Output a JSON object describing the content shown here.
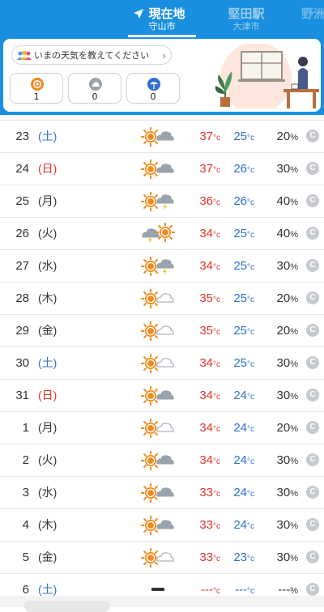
{
  "header": {
    "current": {
      "name": "現在地",
      "sub": "守山市"
    },
    "other": {
      "name": "堅田駅",
      "sub": "大津市"
    },
    "edge": {
      "name": "野洲"
    }
  },
  "report": {
    "prompt": "いまの天気を教えてください",
    "votes": [
      {
        "icon": "sun-icon",
        "count": "1"
      },
      {
        "icon": "cloud-icon",
        "count": "0"
      },
      {
        "icon": "umbrella-icon",
        "count": "0"
      }
    ]
  },
  "forecast": [
    {
      "day": "23",
      "weekday": "(土)",
      "type": "sat",
      "icon": "sun-cloud",
      "high": "37",
      "low": "25",
      "pop": "20"
    },
    {
      "day": "24",
      "weekday": "(日)",
      "type": "sun",
      "icon": "sun-cloud",
      "high": "37",
      "low": "26",
      "pop": "30"
    },
    {
      "day": "25",
      "weekday": "(月)",
      "type": "wk",
      "icon": "sun-thunder",
      "high": "36",
      "low": "26",
      "pop": "40"
    },
    {
      "day": "26",
      "weekday": "(火)",
      "type": "wk",
      "icon": "thunder-sun",
      "high": "34",
      "low": "25",
      "pop": "40"
    },
    {
      "day": "27",
      "weekday": "(水)",
      "type": "wk",
      "icon": "sun-thunder",
      "high": "34",
      "low": "25",
      "pop": "30"
    },
    {
      "day": "28",
      "weekday": "(木)",
      "type": "wk",
      "icon": "sun-white-cloud",
      "high": "35",
      "low": "25",
      "pop": "20"
    },
    {
      "day": "29",
      "weekday": "(金)",
      "type": "wk",
      "icon": "sun-white-cloud",
      "high": "35",
      "low": "25",
      "pop": "20"
    },
    {
      "day": "30",
      "weekday": "(土)",
      "type": "sat",
      "icon": "sun-white-cloud",
      "high": "34",
      "low": "25",
      "pop": "30"
    },
    {
      "day": "31",
      "weekday": "(日)",
      "type": "sun",
      "icon": "sun-cloud",
      "high": "34",
      "low": "24",
      "pop": "30"
    },
    {
      "day": "1",
      "weekday": "(月)",
      "type": "wk",
      "icon": "sun-white-cloud",
      "high": "34",
      "low": "24",
      "pop": "20"
    },
    {
      "day": "2",
      "weekday": "(火)",
      "type": "wk",
      "icon": "sun-cloud",
      "high": "34",
      "low": "24",
      "pop": "30"
    },
    {
      "day": "3",
      "weekday": "(水)",
      "type": "wk",
      "icon": "sun-cloud",
      "high": "33",
      "low": "24",
      "pop": "30"
    },
    {
      "day": "4",
      "weekday": "(木)",
      "type": "wk",
      "icon": "sun-cloud",
      "high": "33",
      "low": "24",
      "pop": "30"
    },
    {
      "day": "5",
      "weekday": "(金)",
      "type": "wk",
      "icon": "sun-white-cloud",
      "high": "33",
      "low": "23",
      "pop": "30"
    },
    {
      "day": "6",
      "weekday": "(土)",
      "type": "sat",
      "icon": "none",
      "high": "---",
      "low": "---",
      "pop": "---"
    }
  ],
  "labels": {
    "unit_c": "°c",
    "unit_pct": "%",
    "detail": "C"
  },
  "colors": {
    "accent": "#1a8fe0",
    "high": "#e0342b",
    "low": "#2f6fd1",
    "saturday": "#2f6fd1",
    "sunday": "#e0342b",
    "sun": "#f08a1d"
  }
}
